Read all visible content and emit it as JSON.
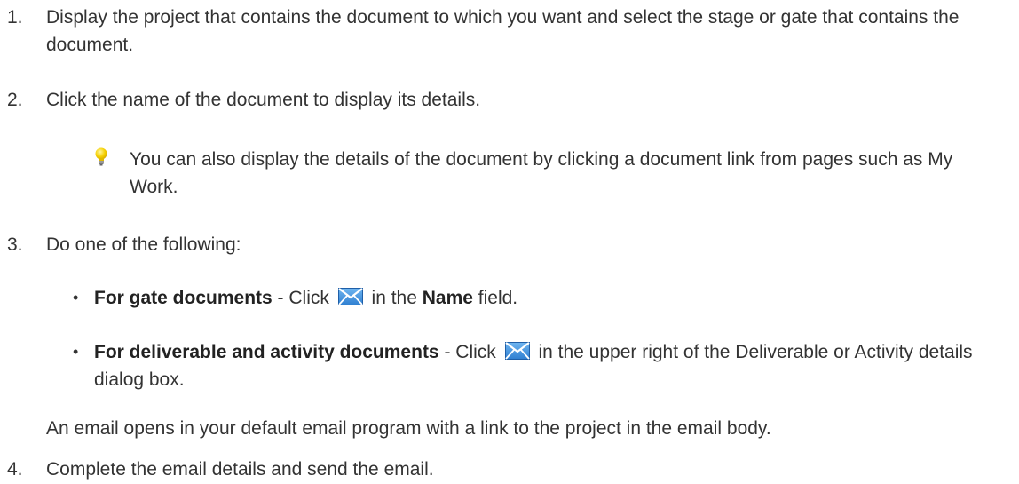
{
  "steps": [
    {
      "number": "1.",
      "text": "Display the project that contains the document to which you want and select the stage or gate that contains the document."
    },
    {
      "number": "2.",
      "text": "Click the name of the document to display its details."
    },
    {
      "number": "3.",
      "text": "Do one of the following:"
    },
    {
      "number": "4.",
      "text": "Complete the email details and send the email."
    }
  ],
  "tip": {
    "icon": "lightbulb-icon",
    "text": "You can also display the details of the document by clicking a document link from pages such as My Work."
  },
  "bullets": [
    {
      "bold": "For gate documents",
      "text_before_icon": " - Click ",
      "icon": "email-icon",
      "text_after_icon": " in the ",
      "bold2": "Name",
      "text_end": " field."
    },
    {
      "bold": "For deliverable and activity documents",
      "text_before_icon": " - Click ",
      "icon": "email-icon",
      "text_after_icon": " in the upper right of the Deliverable or Activity details dialog box."
    }
  ],
  "result_text": "An email opens in your default email program with a link to the project in the email body.",
  "colors": {
    "text": "#333333",
    "icon_blue": "#2f7fd1",
    "bulb_yellow": "#f5d000"
  }
}
